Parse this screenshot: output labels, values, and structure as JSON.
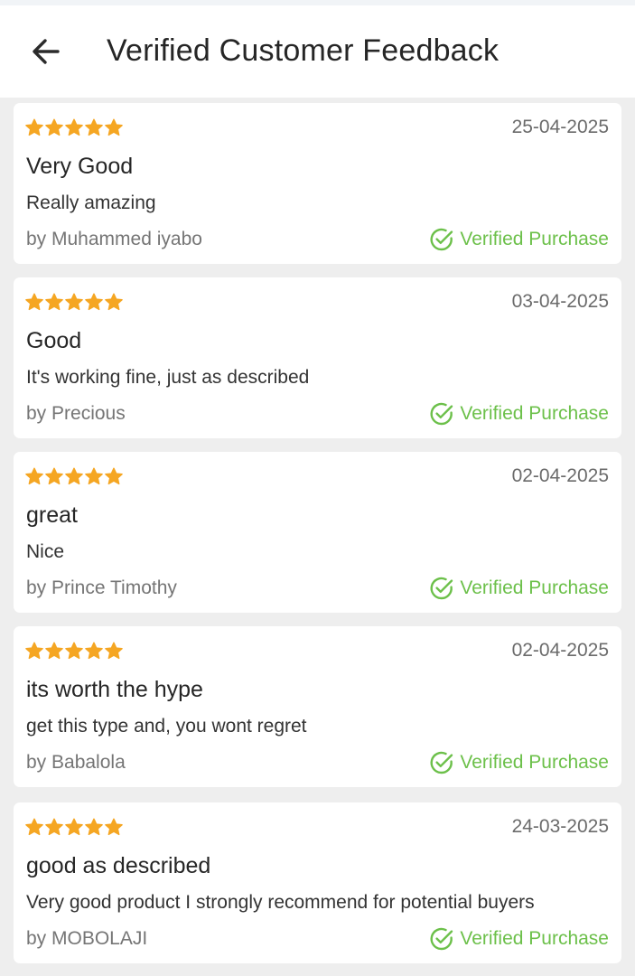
{
  "header": {
    "back_icon": "arrow-left-icon",
    "title": "Verified Customer Feedback"
  },
  "colors": {
    "star": "#f5a623",
    "verified": "#6cc04a",
    "background": "#eeeeee",
    "card": "#ffffff"
  },
  "reviews": [
    {
      "rating": 5,
      "date": "25-04-2025",
      "title": "Very Good",
      "body": "Really amazing",
      "author": "by Muhammed iyabo",
      "verified_label": "Verified Purchase"
    },
    {
      "rating": 5,
      "date": "03-04-2025",
      "title": "Good",
      "body": "It's working fine, just as described",
      "author": "by Precious",
      "verified_label": "Verified Purchase"
    },
    {
      "rating": 5,
      "date": "02-04-2025",
      "title": "great",
      "body": "Nice",
      "author": "by Prince Timothy",
      "verified_label": "Verified Purchase"
    },
    {
      "rating": 5,
      "date": "02-04-2025",
      "title": "its worth the hype",
      "body": "get this type and, you wont regret",
      "author": "by Babalola",
      "verified_label": "Verified Purchase"
    },
    {
      "rating": 5,
      "date": "24-03-2025",
      "title": "good as described",
      "body": "Very good product I strongly recommend for potential buyers",
      "author": "by MOBOLAJI",
      "verified_label": "Verified Purchase"
    }
  ]
}
